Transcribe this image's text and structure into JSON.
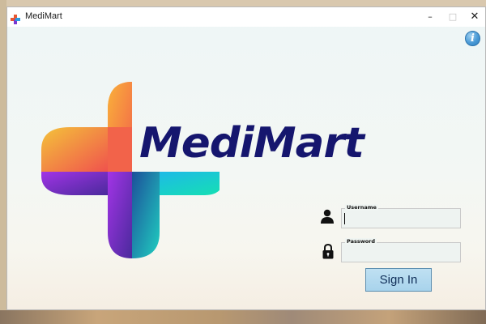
{
  "window": {
    "title": "MediMart",
    "controls": {
      "minimize": "–",
      "maximize": "□",
      "close": "✕"
    }
  },
  "info_button": {
    "label": "i",
    "icon": "info-icon"
  },
  "brand": {
    "name": "MediMart",
    "logo": "medical-cross-logo",
    "text_color": "#15166e",
    "gradient_colors": [
      "#f6a53a",
      "#f26a4b",
      "#9a38e0",
      "#2aa6e8",
      "#1fd6b8"
    ]
  },
  "login": {
    "username": {
      "label": "Username",
      "value": "",
      "icon": "user-icon"
    },
    "password": {
      "label": "Password",
      "value": "",
      "icon": "lock-icon"
    },
    "sign_in_label": "Sign In"
  }
}
